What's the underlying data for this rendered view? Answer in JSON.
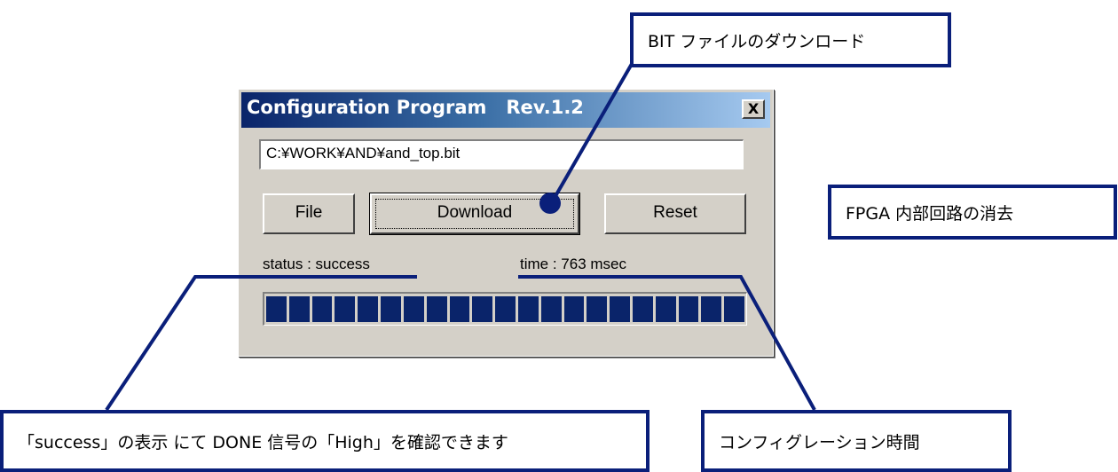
{
  "dialog": {
    "title": "Configuration Program   Rev.1.2",
    "close_label": "X",
    "path_value": "C:¥WORK¥AND¥and_top.bit",
    "buttons": {
      "file": "File",
      "download": "Download",
      "reset": "Reset"
    },
    "status_text": "status : success",
    "time_text": "time : 763 msec",
    "progress": 1.0,
    "progress_color": "#0a246a"
  },
  "callouts": {
    "download": "BIT ファイルのダウンロード",
    "reset": "FPGA 内部回路の消去",
    "success": "「success」の表示 にて DONE 信号の「High」を確認できます",
    "time": "コンフィグレーション時間"
  },
  "colors": {
    "callout_border": "#0a1f7a",
    "window_bg": "#d4d0c8",
    "title_gradient_start": "#0a246a"
  }
}
